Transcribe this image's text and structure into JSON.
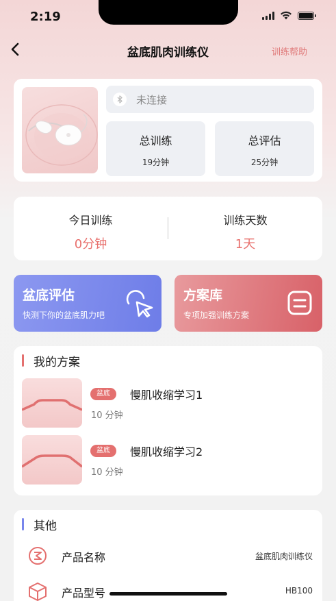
{
  "status_bar": {
    "time": "2:19"
  },
  "nav": {
    "title": "盆底肌肉训练仪",
    "help_label": "训练帮助"
  },
  "device": {
    "connection_status": "未连接",
    "stats": [
      {
        "label": "总训练",
        "value": "19分钟"
      },
      {
        "label": "总评估",
        "value": "25分钟"
      }
    ]
  },
  "today": {
    "training": {
      "label": "今日训练",
      "value": "0分钟"
    },
    "days": {
      "label": "训练天数",
      "value": "1天"
    }
  },
  "actions": {
    "evaluate": {
      "title": "盆底评估",
      "subtitle": "快测下你的盆底肌力吧"
    },
    "library": {
      "title": "方案库",
      "subtitle": "专项加强训练方案"
    }
  },
  "my_plans": {
    "title": "我的方案",
    "items": [
      {
        "tag": "盆底",
        "name": "慢肌收缩学习1",
        "duration": "10 分钟"
      },
      {
        "tag": "盆底",
        "name": "慢肌收缩学习2",
        "duration": "10 分钟"
      }
    ]
  },
  "other": {
    "title": "其他",
    "rows": [
      {
        "label": "产品名称",
        "value": "盆底肌肉训练仪",
        "icon": "product-name-icon"
      },
      {
        "label": "产品型号",
        "value": "HB100",
        "icon": "cube-icon"
      }
    ]
  },
  "colors": {
    "accent_red": "#e8706d",
    "eval_blue": "#7885ec",
    "library_red": "#dd6d72"
  }
}
